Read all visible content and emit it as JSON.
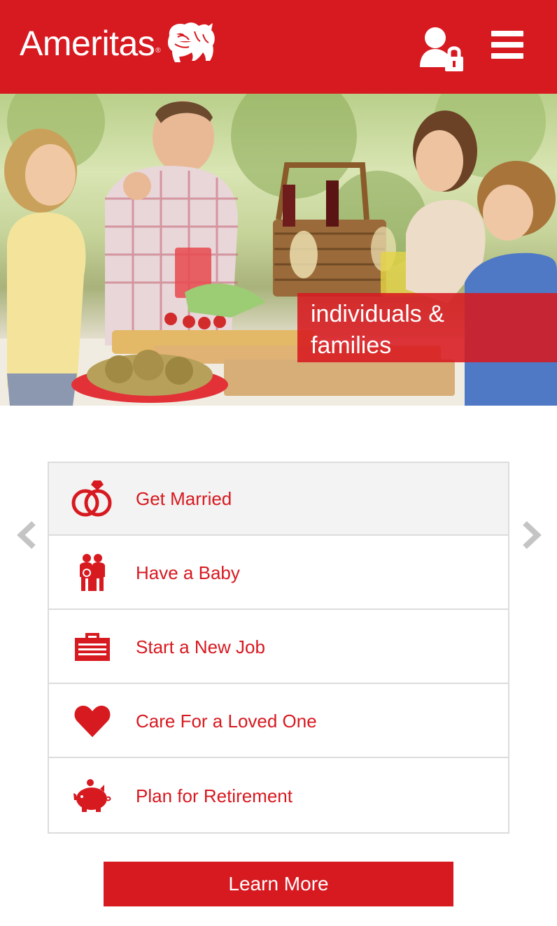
{
  "header": {
    "brand": "Ameritas",
    "brand_mark": "®",
    "login_icon": "user-lock-icon",
    "menu_icon": "hamburger-menu-icon",
    "brand_color": "#d71920"
  },
  "hero": {
    "image_label": "photo",
    "caption_line1": "individuals &",
    "caption_line2": "families"
  },
  "life_events": {
    "items": [
      {
        "label": "Get Married",
        "icon": "wedding-rings-icon",
        "active": true
      },
      {
        "label": "Have a Baby",
        "icon": "family-icon",
        "active": false
      },
      {
        "label": "Start a New Job",
        "icon": "briefcase-icon",
        "active": false
      },
      {
        "label": "Care For a Loved One",
        "icon": "heart-icon",
        "active": false
      },
      {
        "label": "Plan for Retirement",
        "icon": "piggy-bank-icon",
        "active": false
      }
    ],
    "prev_icon": "chevron-left-icon",
    "next_icon": "chevron-right-icon"
  },
  "cta": {
    "label": "Learn More"
  }
}
